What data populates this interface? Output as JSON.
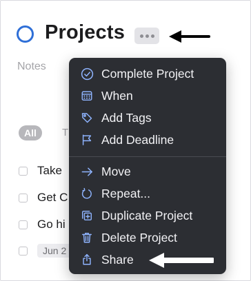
{
  "project": {
    "title": "Projects",
    "notes_placeholder": "Notes"
  },
  "filters": {
    "all_label": "All",
    "partial_label": "T"
  },
  "todos": [
    {
      "text": "Take"
    },
    {
      "text": "Get C"
    },
    {
      "text": "Go hi"
    },
    {
      "date": "Jun 2"
    }
  ],
  "menu": {
    "items": [
      {
        "label": "Complete Project",
        "icon": "check-circle-icon"
      },
      {
        "label": "When",
        "icon": "calendar-icon"
      },
      {
        "label": "Add Tags",
        "icon": "tag-icon"
      },
      {
        "label": "Add Deadline",
        "icon": "flag-icon"
      },
      {
        "label": "Move",
        "icon": "arrow-right-icon"
      },
      {
        "label": "Repeat...",
        "icon": "repeat-icon"
      },
      {
        "label": "Duplicate Project",
        "icon": "duplicate-icon"
      },
      {
        "label": "Delete Project",
        "icon": "trash-icon"
      },
      {
        "label": "Share",
        "icon": "share-icon"
      }
    ]
  },
  "colors": {
    "accent": "#2f6fd7",
    "menu_background": "#2c2e33",
    "menu_icon": "#8fb4ff",
    "annotation_arrow": "#000000"
  }
}
